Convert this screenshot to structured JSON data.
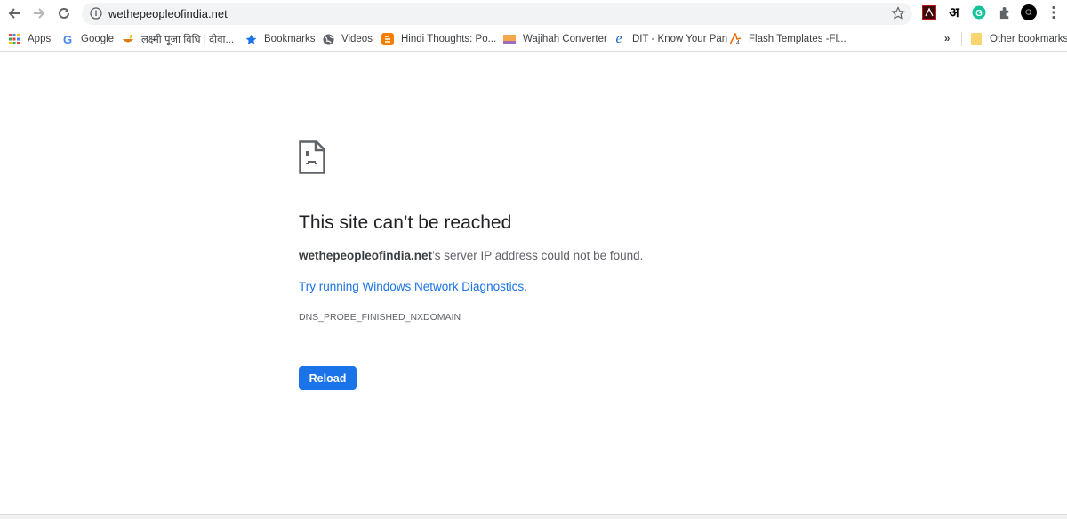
{
  "browser": {
    "url": "wethepeopleofindia.net",
    "nav": {
      "back_icon": "arrow-left-icon",
      "forward_icon": "arrow-right-icon",
      "reload_icon": "reload-icon"
    },
    "extensions": [
      {
        "name": "adobe-acrobat",
        "glyph": "A",
        "color": "#c21a1a"
      },
      {
        "name": "hindi-input",
        "glyph": "अ",
        "color": "#000000"
      },
      {
        "name": "grammarly",
        "glyph": "G",
        "color": "#15c39a"
      },
      {
        "name": "extensions-puzzle",
        "glyph": "",
        "color": "#5f6368"
      },
      {
        "name": "profile-search",
        "glyph": "",
        "color": "#000000"
      }
    ]
  },
  "bookmarks": {
    "items": [
      {
        "label": "Apps",
        "icon": "apps-grid-icon"
      },
      {
        "label": "Google",
        "icon": "google-icon"
      },
      {
        "label": "लक्ष्मी पूजा विधि | दीवा...",
        "icon": "diya-icon"
      },
      {
        "label": "Bookmarks",
        "icon": "star-icon"
      },
      {
        "label": "Videos",
        "icon": "globe-icon"
      },
      {
        "label": "Hindi Thoughts: Po...",
        "icon": "blogger-icon"
      },
      {
        "label": "Wajihah Converter",
        "icon": "converter-icon"
      },
      {
        "label": "DIT - Know Your Pan",
        "icon": "ie-icon"
      },
      {
        "label": "Flash Templates -Fl...",
        "icon": "flash-templates-icon"
      }
    ],
    "overflow": "»",
    "other": "Other bookmarks"
  },
  "error": {
    "title": "This site can’t be reached",
    "host": "wethepeopleofindia.net",
    "message": "’s server IP address could not be found.",
    "link": "Try running Windows Network Diagnostics.",
    "code": "DNS_PROBE_FINISHED_NXDOMAIN",
    "reload": "Reload"
  },
  "colors": {
    "accent": "#1a73e8",
    "text_primary": "#202124",
    "text_secondary": "#5f6368"
  }
}
